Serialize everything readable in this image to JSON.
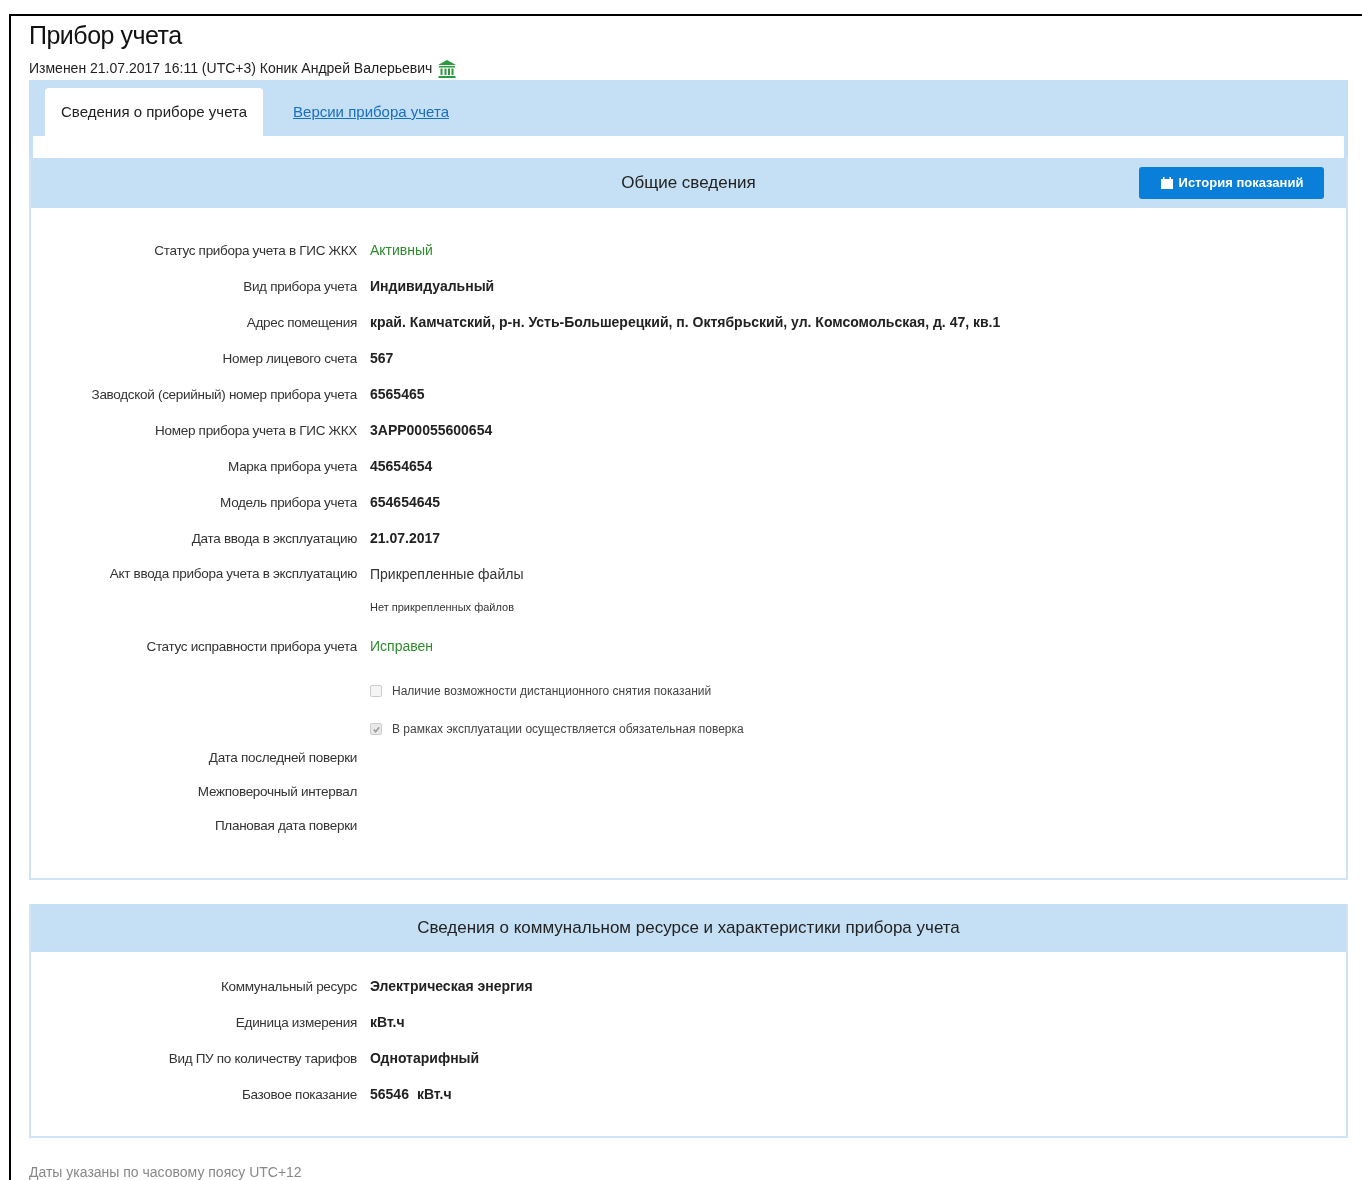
{
  "title": "Прибор учета",
  "modified": "Изменен 21.07.2017 16:11 (UTC+3) Коник Андрей Валерьевич",
  "tabs": [
    {
      "label": "Сведения о приборе учета",
      "selected": true
    },
    {
      "label": "Версии прибора учета",
      "selected": false
    }
  ],
  "general": {
    "title": "Общие сведения",
    "history_button": "История показаний",
    "rows": [
      {
        "kind": "status",
        "label": "Статус прибора учета в ГИС ЖКХ",
        "value": "Активный"
      },
      {
        "kind": "bold",
        "label": "Вид прибора учета",
        "value": "Индивидуальный"
      },
      {
        "kind": "bold",
        "label": "Адрес помещения",
        "value": "край. Камчатский, р-н. Усть-Большерецкий, п. Октябрьский, ул. Комсомольская, д. 47, кв.1"
      },
      {
        "kind": "bold",
        "label": "Номер лицевого счета",
        "value": "567"
      },
      {
        "kind": "bold",
        "label": "Заводской (серийный) номер прибора учета",
        "value": "6565465"
      },
      {
        "kind": "bold",
        "label": "Номер прибора учета в ГИС ЖКХ",
        "value": "3APP00055600654"
      },
      {
        "kind": "bold",
        "label": "Марка прибора учета",
        "value": "45654654"
      },
      {
        "kind": "bold",
        "label": "Модель прибора учета",
        "value": "654654645"
      },
      {
        "kind": "bold",
        "label": "Дата ввода в эксплуатацию",
        "value": "21.07.2017"
      },
      {
        "kind": "files",
        "label": "Акт ввода прибора учета в эксплуатацию",
        "value": "Прикрепленные файлы",
        "note": "Нет прикрепленных файлов"
      },
      {
        "kind": "status",
        "label": "Статус исправности прибора учета",
        "value": "Исправен"
      },
      {
        "kind": "checkbox",
        "text": "Наличие возможности дистанционного снятия показаний",
        "checked": false
      },
      {
        "kind": "checkbox",
        "text": "В рамках эксплуатации осуществляется обязательная поверка",
        "checked": true
      },
      {
        "kind": "empty",
        "label": "Дата последней поверки"
      },
      {
        "kind": "empty",
        "label": "Межповерочный интервал"
      },
      {
        "kind": "empty",
        "label": "Плановая дата поверки"
      }
    ]
  },
  "resource": {
    "title": "Сведения о коммунальном ресурсе и характеристики прибора учета",
    "rows": [
      {
        "kind": "bold",
        "label": "Коммунальный ресурс",
        "value": "Электрическая энергия"
      },
      {
        "kind": "bold",
        "label": "Единица измерения",
        "value": "кВт.ч"
      },
      {
        "kind": "bold",
        "label": "Вид ПУ по количеству тарифов",
        "value": "Однотарифный"
      },
      {
        "kind": "reading",
        "label": "Базовое показание",
        "value": "56546",
        "unit": "кВт.ч"
      }
    ]
  },
  "footer": "Даты указаны по часовому поясу UTC+12"
}
